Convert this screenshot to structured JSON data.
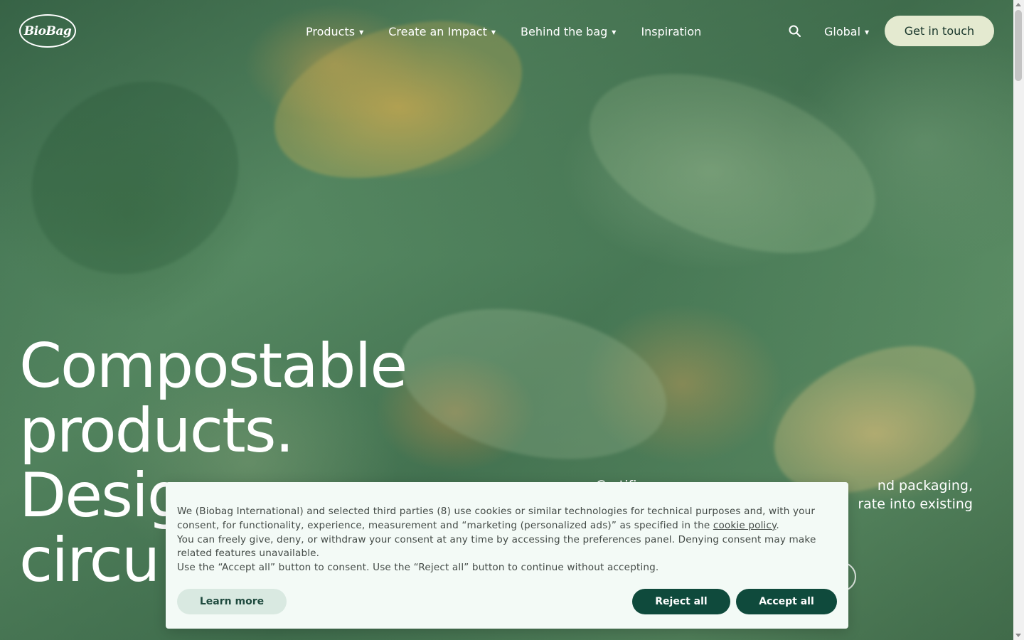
{
  "brand": {
    "logo_text": "BioBag"
  },
  "nav": {
    "items": [
      {
        "label": "Products",
        "has_dropdown": true
      },
      {
        "label": "Create an Impact",
        "has_dropdown": true
      },
      {
        "label": "Behind the bag",
        "has_dropdown": true
      },
      {
        "label": "Inspiration",
        "has_dropdown": false
      }
    ],
    "search_icon": "search-icon",
    "region_label": "Global",
    "cta_label": "Get in touch"
  },
  "hero": {
    "headline_lines": [
      "Compostable",
      "products.",
      "Desig",
      "circu"
    ],
    "subcopy_line1": "Certifi",
    "subcopy_line1_end": "nd packaging,",
    "subcopy_line2_end": "rate into existing"
  },
  "cookie_banner": {
    "para1_before_link": "We (Biobag International) and selected third parties (8) use cookies or similar technologies for technical purposes and, with your consent, for functionality, experience, measurement and “marketing (personalized ads)” as specified in the ",
    "policy_link": "cookie policy",
    "para1_after_link": ".",
    "para2": "You can freely give, deny, or withdraw your consent at any time by accessing the preferences panel. Denying consent may make related features unavailable.",
    "para3": "Use the “Accept all” button to consent. Use the “Reject all” button to continue without accepting.",
    "learn_more": "Learn more",
    "reject_all": "Reject all",
    "accept_all": "Accept all"
  },
  "colors": {
    "cta_bg": "#e4ead0",
    "banner_bg": "#f3faf6",
    "primary_button": "#0f4a3c",
    "secondary_button": "#d9e9e1"
  }
}
